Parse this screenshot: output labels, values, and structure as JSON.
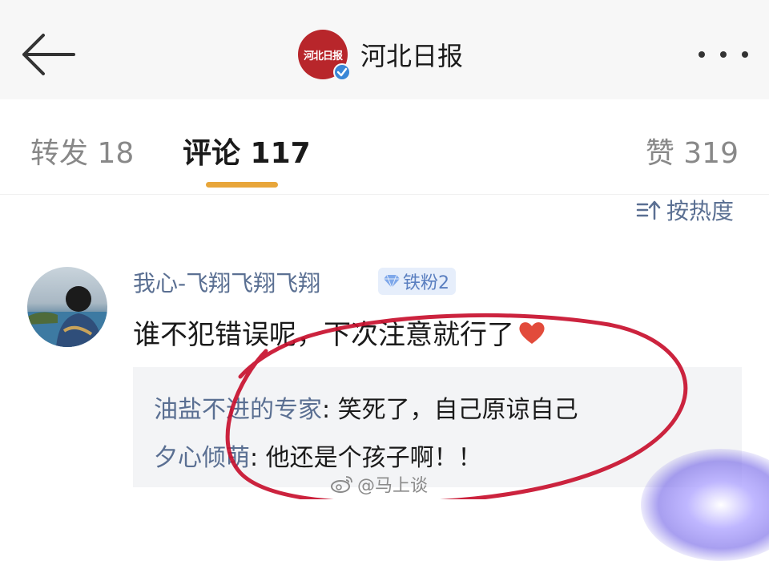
{
  "header": {
    "title": "河北日报",
    "logo_text": "河北日报"
  },
  "tabs": {
    "repost": "转发 18",
    "comment": "评论 117",
    "like": "赞 319"
  },
  "sort": {
    "label": "按热度"
  },
  "comment": {
    "username": "我心-飞翔飞翔飞翔",
    "badge": "铁粉2",
    "text": "谁不犯错误呢，下次注意就行了"
  },
  "replies": [
    {
      "user": "油盐不进的专家",
      "text": ": 笑死了，自己原谅自己"
    },
    {
      "user": "夕心倾萌",
      "text": ": 他还是个孩子啊！！"
    }
  ],
  "watermark": "@马上谈",
  "colors": {
    "accent_underline": "#e8a63a",
    "link_blue": "#5a6f92",
    "annotation_red": "#c8102e",
    "logo_red": "#b8262b"
  }
}
